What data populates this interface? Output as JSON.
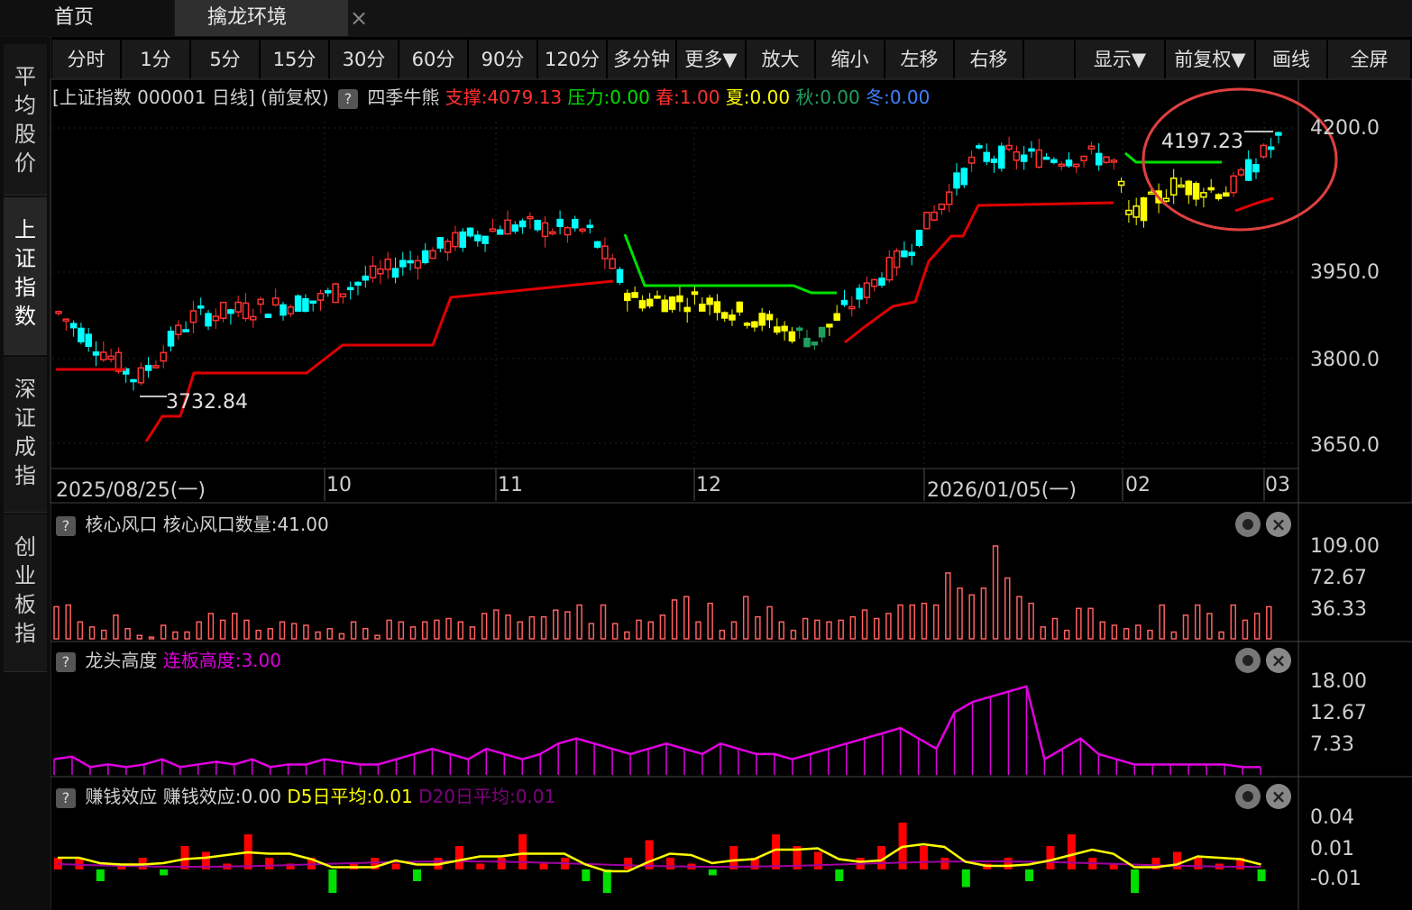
{
  "tabs": {
    "home": "首页",
    "active": "擒龙环境",
    "close": "×"
  },
  "sidebar": [
    {
      "label": "平均股价",
      "active": false
    },
    {
      "label": "上证指数",
      "active": true
    },
    {
      "label": "深证成指",
      "active": false
    },
    {
      "label": "创业板指",
      "active": false
    }
  ],
  "toolbar": [
    "分时",
    "1分",
    "5分",
    "15分",
    "30分",
    "60分",
    "90分",
    "120分",
    "多分钟",
    "更多▼",
    "放大",
    "缩小",
    "左移",
    "右移",
    "",
    "显示▼",
    "前复权▼",
    "画线",
    "全屏"
  ],
  "header": {
    "title": "[上证指数 000001 日线]",
    "adj": "(前复权)",
    "help": "?",
    "indicator": "四季牛熊",
    "support": "支撑:4079.13",
    "pressure": "压力:0.00",
    "spring": "春:1.00",
    "summer": "夏:0.00",
    "autumn": "秋:0.00",
    "winter": "冬:0.00"
  },
  "main_chart": {
    "yticks": [
      "4200.0",
      "3950.0",
      "3800.0",
      "3650.0"
    ],
    "dates": [
      "2025/08/25(一)",
      "10",
      "11",
      "12",
      "2026/01/05(一)",
      "02",
      "03"
    ],
    "high_label": "4197.23",
    "low_label": "3732.84"
  },
  "panel1": {
    "help": "?",
    "name": "核心风口",
    "value": "核心风口数量:41.00",
    "yticks": [
      "109.00",
      "72.67",
      "36.33"
    ]
  },
  "panel2": {
    "help": "?",
    "name": "龙头高度",
    "value": "连板高度:3.00",
    "yticks": [
      "18.00",
      "12.67",
      "7.33"
    ]
  },
  "panel3": {
    "help": "?",
    "name": "赚钱效应",
    "value": "赚钱效应:0.00",
    "d5": "D5日平均:0.01",
    "d20": "D20日平均:0.01",
    "yticks": [
      "0.04",
      "0.01",
      "-0.01"
    ]
  },
  "colors": {
    "up": "#ff3030",
    "down": "#00ffff",
    "yellow": "#ffff00",
    "green": "#00e000",
    "magenta": "#e000e0",
    "bar": "#ff6060",
    "annot": "#e04040"
  },
  "chart_data": [
    {
      "type": "candlestick",
      "title": "上证指数 000001 日线",
      "ylim": [
        3600,
        4230
      ],
      "x": [
        "2025/08/25",
        "10",
        "11",
        "12",
        "2026/01/05",
        "02",
        "03"
      ],
      "series": [
        {
          "name": "支撑",
          "values": [
            3790,
            3790,
            3790,
            3820,
            3820,
            3850,
            3850,
            3890,
            3920,
            3920,
            3920,
            3920,
            3920,
            3920,
            3920,
            3900,
            3900,
            3880,
            4080,
            4080,
            4080,
            4080,
            4080,
            4080,
            4080
          ]
        }
      ]
    },
    {
      "type": "bar",
      "title": "核心风口",
      "ylim": [
        0,
        115
      ],
      "values": [
        38,
        40,
        20,
        14,
        10,
        28,
        12,
        4,
        2,
        16,
        8,
        8,
        20,
        30,
        22,
        30,
        22,
        10,
        12,
        20,
        18,
        16,
        8,
        12,
        6,
        20,
        12,
        4,
        22,
        20,
        14,
        20,
        22,
        24,
        20,
        14,
        30,
        34,
        28,
        20,
        26,
        26,
        34,
        32,
        40,
        18,
        40,
        18,
        8,
        22,
        20,
        28,
        46,
        50,
        20,
        42,
        10,
        20,
        50,
        26,
        38,
        20,
        10,
        24,
        22,
        20,
        22,
        26,
        34,
        24,
        30,
        40,
        40,
        42,
        40,
        78,
        60,
        52,
        60,
        110,
        72,
        50,
        42,
        14,
        24,
        10,
        36,
        36,
        20,
        16,
        12,
        16,
        10,
        40,
        8,
        28,
        40,
        30,
        8,
        40,
        22,
        30,
        38
      ]
    },
    {
      "type": "line",
      "title": "龙头高度",
      "ylim": [
        0,
        19
      ],
      "values": [
        3,
        3.5,
        1.5,
        2,
        1.5,
        2,
        3,
        1.5,
        2,
        2.5,
        2,
        3,
        1.5,
        2,
        2,
        3,
        2.5,
        2,
        2,
        3,
        4,
        5,
        4,
        3,
        5,
        4,
        3,
        4,
        6,
        7,
        6,
        5,
        4,
        5,
        6,
        5,
        4,
        6,
        5,
        4,
        4,
        3,
        4,
        5,
        6,
        7,
        8,
        9,
        7,
        5,
        12,
        14,
        15,
        16,
        17,
        3,
        5,
        7,
        4,
        3,
        2,
        2,
        2,
        2,
        2,
        2,
        1.5,
        1.5
      ]
    },
    {
      "type": "bar",
      "title": "赚钱效应",
      "ylim": [
        -0.03,
        0.045
      ],
      "values": [
        0.01,
        0.01,
        -0.01,
        0.005,
        0.01,
        -0.005,
        0.02,
        0.015,
        0.005,
        0.03,
        0.01,
        0.005,
        0.01,
        -0.02,
        0.005,
        0.01,
        0.005,
        -0.01,
        0.01,
        0.02,
        0.005,
        0.01,
        0.03,
        0.005,
        0.01,
        -0.01,
        -0.02,
        0.01,
        0.025,
        0.01,
        0.005,
        -0.005,
        0.02,
        0.01,
        0.03,
        0.02,
        0.015,
        -0.01,
        0.01,
        0.02,
        0.04,
        0.02,
        0.01,
        -0.015,
        0.005,
        0.01,
        -0.01,
        0.02,
        0.03,
        0.01,
        0.005,
        -0.02,
        0.01,
        0.015,
        0.01,
        0.005,
        0.01,
        -0.01
      ]
    }
  ]
}
